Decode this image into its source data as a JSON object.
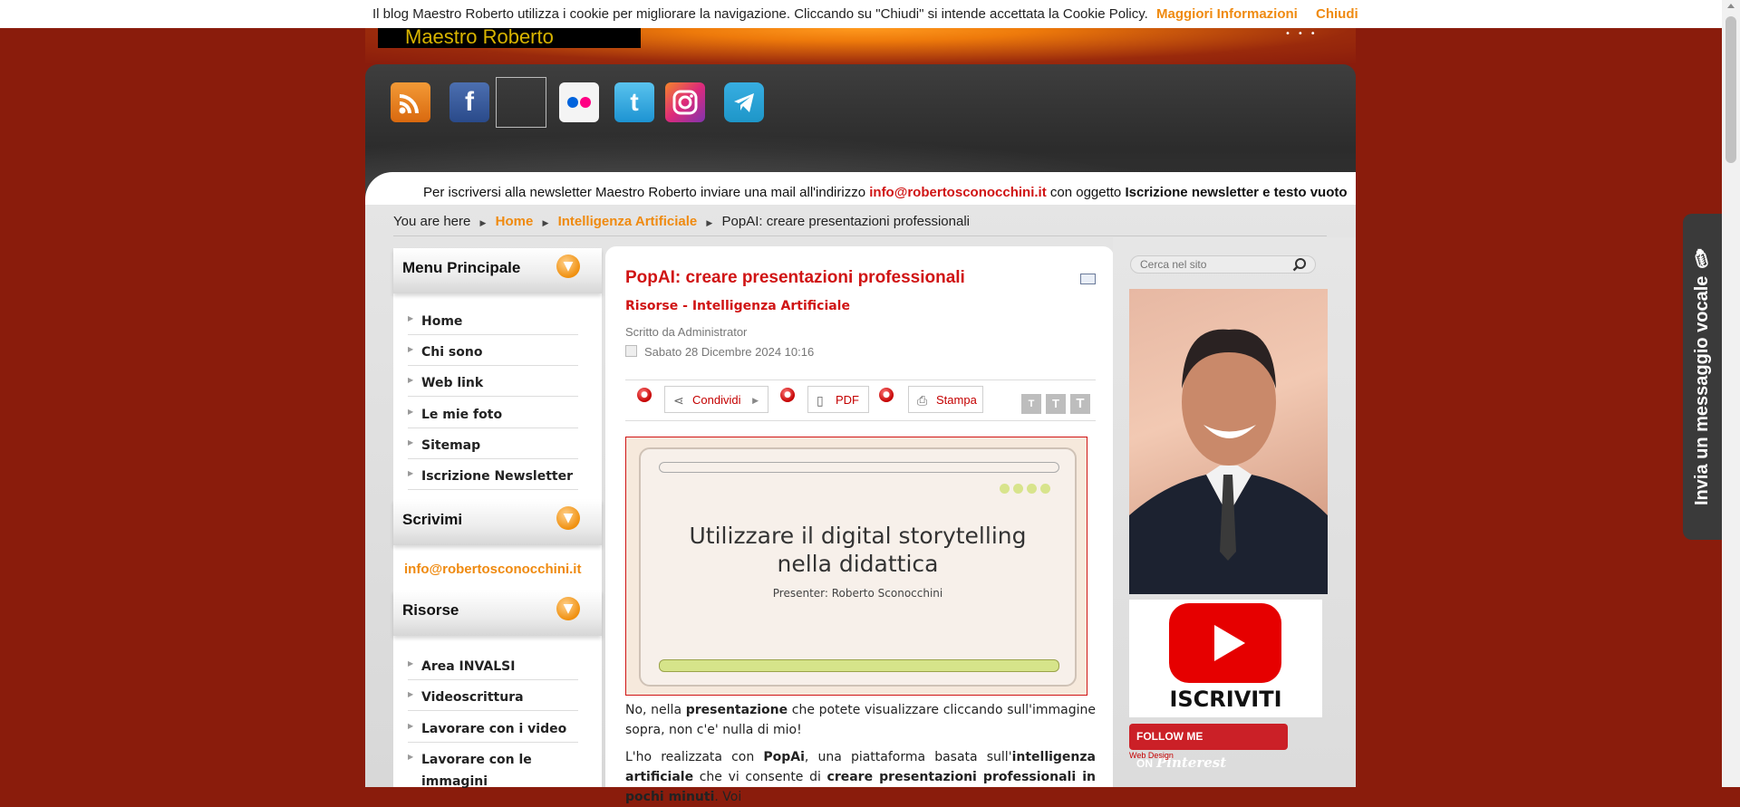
{
  "cookie": {
    "message": "Il blog Maestro Roberto utilizza i cookie per migliorare la navigazione. Cliccando su \"Chiudi\" si intende accettata la Cookie Policy.",
    "more_label": "Maggiori Informazioni",
    "close_label": "Chiudi"
  },
  "logo": {
    "text": "Maestro Roberto"
  },
  "social": [
    "rss-icon",
    "facebook-icon",
    "broken-image",
    "flickr-icon",
    "twitter-icon",
    "instagram-icon",
    "telegram-icon"
  ],
  "newsletter": {
    "prefix": "Per iscriversi alla newsletter Maestro Roberto inviare una mail all'indirizzo",
    "email": "info@robertosconocchini.it",
    "middle": "con oggetto",
    "subject": "Iscrizione newsletter e testo vuoto"
  },
  "breadcrumb": {
    "prefix": "You are here",
    "home": "Home",
    "category": "Intelligenza Artificiale",
    "current": "PopAI: creare presentazioni professionali"
  },
  "sidebar": {
    "menu_title": "Menu Principale",
    "menu_items": [
      "Home",
      "Chi sono",
      "Web link",
      "Le mie foto",
      "Sitemap",
      "Iscrizione Newsletter"
    ],
    "write_title": "Scrivimi",
    "write_email": "info@robertosconocchini.it",
    "resources_title": "Risorse",
    "resources_items": [
      "Area INVALSI",
      "Videoscrittura",
      "Lavorare con i video",
      "Lavorare con le immagini"
    ]
  },
  "article": {
    "title": "PopAI: creare presentazioni professionali",
    "category": "Risorse - Intelligenza Artificiale",
    "author": "Scritto da Administrator",
    "date": "Sabato 28 Dicembre 2024 10:16",
    "share_label": "Condividi",
    "pdf_label": "PDF",
    "print_label": "Stampa",
    "font_sizes": [
      "T",
      "T",
      "T"
    ],
    "slide": {
      "line1": "Utilizzare il digital storytelling",
      "line2": "nella didattica",
      "presenter": "Presenter: Roberto Sconocchini"
    },
    "p1": {
      "a": "No, nella ",
      "b": "presentazione",
      "c": " che potete visualizzare cliccando sull'immagine sopra, non c'e' nulla di mio!"
    },
    "p2": {
      "a": "L'ho realizzata con ",
      "b": "PopAi",
      "c": ", una piattaforma basata sull'",
      "d": "intelligenza artificiale",
      "e": " che vi consente di ",
      "f": "creare presentazioni professionali in pochi minuti",
      "g": ". Voi"
    }
  },
  "right": {
    "search_placeholder": "Cerca nel sito",
    "youtube_label": "ISCRIVITI",
    "pinterest_prefix": "FOLLOW ME ON",
    "pinterest_brand": "Pinterest",
    "webdesign": "Web Design"
  },
  "voice": {
    "label": "Invia un messaggio vocale"
  }
}
